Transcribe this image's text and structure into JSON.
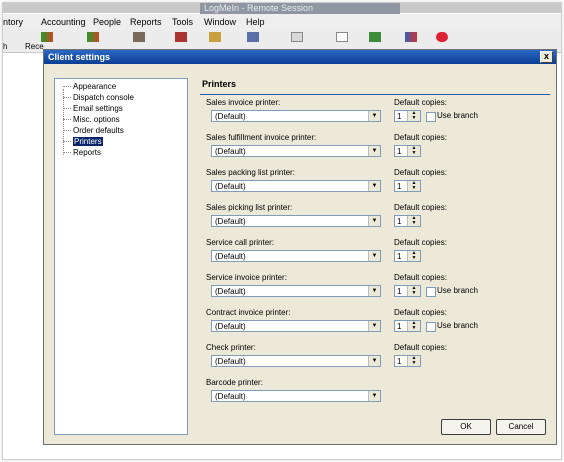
{
  "background_app": {
    "window_title": "LogMeIn - Remote Session",
    "menu": [
      "ntory",
      "Accounting",
      "People",
      "Reports",
      "Tools",
      "Window",
      "Help"
    ],
    "toolbar_labels": [
      "h",
      "Rece"
    ]
  },
  "dialog": {
    "title": "Client settings",
    "close_label": "x",
    "tree": [
      {
        "label": "Appearance",
        "selected": false
      },
      {
        "label": "Dispatch console",
        "selected": false
      },
      {
        "label": "Email settings",
        "selected": false
      },
      {
        "label": "Misc. options",
        "selected": false
      },
      {
        "label": "Order defaults",
        "selected": false
      },
      {
        "label": "Printers",
        "selected": true
      },
      {
        "label": "Reports",
        "selected": false
      }
    ],
    "panel_title": "Printers",
    "copies_label": "Default copies:",
    "use_branch_label": "Use branch",
    "printers": [
      {
        "label": "Sales invoice printer:",
        "value": "(Default)",
        "copies": "1",
        "use_branch": true
      },
      {
        "label": "Sales fulfillment invoice printer:",
        "value": "(Default)",
        "copies": "1",
        "use_branch": false
      },
      {
        "label": "Sales packing list printer:",
        "value": "(Default)",
        "copies": "1",
        "use_branch": false
      },
      {
        "label": "Sales picking list printer:",
        "value": "(Default)",
        "copies": "1",
        "use_branch": false
      },
      {
        "label": "Service call printer:",
        "value": "(Default)",
        "copies": "1",
        "use_branch": false
      },
      {
        "label": "Service invoice printer:",
        "value": "(Default)",
        "copies": "1",
        "use_branch": true
      },
      {
        "label": "Contract invoice printer:",
        "value": "(Default)",
        "copies": "1",
        "use_branch": true
      },
      {
        "label": "Check printer:",
        "value": "(Default)",
        "copies": "1",
        "use_branch": false
      },
      {
        "label": "Barcode printer:",
        "value": "(Default)",
        "copies": null,
        "use_branch": false
      }
    ],
    "ok_label": "OK",
    "cancel_label": "Cancel"
  }
}
